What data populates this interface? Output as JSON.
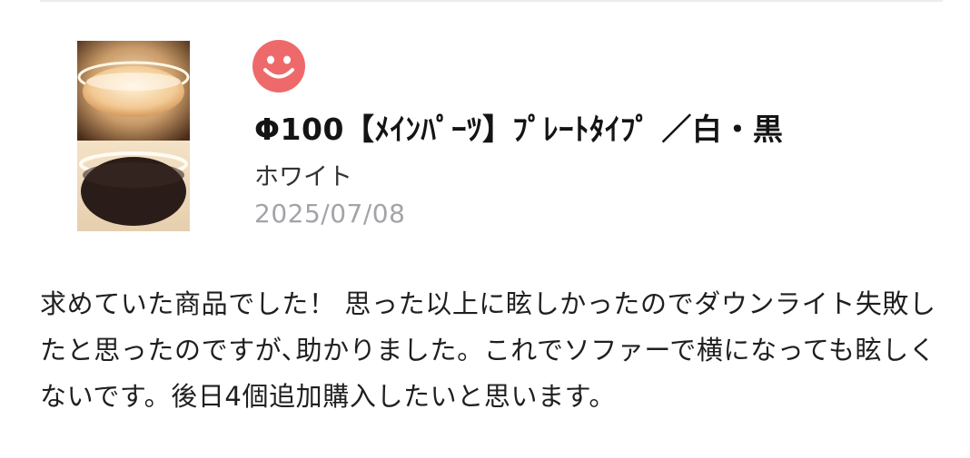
{
  "review": {
    "product_name": "Φ100【ﾒｲﾝﾊﾟｰﾂ】ﾌﾟﾚｰﾄﾀｲﾌﾟ ／白・黒",
    "variant": "ホワイト",
    "date": "2025/07/08",
    "rating_icon": "smile-face-icon",
    "rating_color": "#ee6a6a",
    "text": "求めていた商品でした！ 思った以上に眩しかったのでダウンライト失敗したと思ったのですが､助かりました。これでソファーで横になっても眩しくないです。後日4個追加購入したいと思います。"
  },
  "thumbnail": {
    "icon": "product-photo-ceiling-light"
  }
}
